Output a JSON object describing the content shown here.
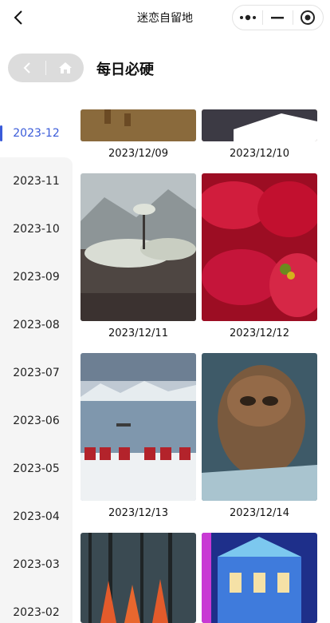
{
  "navbar": {
    "title": "迷恋自留地",
    "back_icon": "chevron-left-icon",
    "more_icon": "more-dots-icon",
    "minimize_icon": "minimize-icon",
    "close_icon": "target-circle-icon"
  },
  "header": {
    "title": "每日必硬",
    "pill_back_icon": "chevron-left-icon",
    "pill_home_icon": "home-icon"
  },
  "sidebar": {
    "active_color": "#3a5bd9",
    "months": [
      {
        "label": "2023-12",
        "active": true
      },
      {
        "label": "2023-11",
        "active": false
      },
      {
        "label": "2023-10",
        "active": false
      },
      {
        "label": "2023-09",
        "active": false
      },
      {
        "label": "2023-08",
        "active": false
      },
      {
        "label": "2023-07",
        "active": false
      },
      {
        "label": "2023-06",
        "active": false
      },
      {
        "label": "2023-05",
        "active": false
      },
      {
        "label": "2023-04",
        "active": false
      },
      {
        "label": "2023-03",
        "active": false
      },
      {
        "label": "2023-02",
        "active": false
      }
    ]
  },
  "wallpapers": [
    {
      "date": "2023/12/09",
      "image": "deer-mountain-landscape"
    },
    {
      "date": "2023/12/10",
      "image": "sunset-coast"
    },
    {
      "date": "2023/12/11",
      "image": "snowy-pine-cliff"
    },
    {
      "date": "2023/12/12",
      "image": "red-poinsettia"
    },
    {
      "date": "2023/12/13",
      "image": "norway-fishing-village"
    },
    {
      "date": "2023/12/14",
      "image": "owl-in-pine"
    },
    {
      "date": "",
      "image": "winter-forest-cones"
    },
    {
      "date": "",
      "image": "illuminated-building"
    }
  ]
}
